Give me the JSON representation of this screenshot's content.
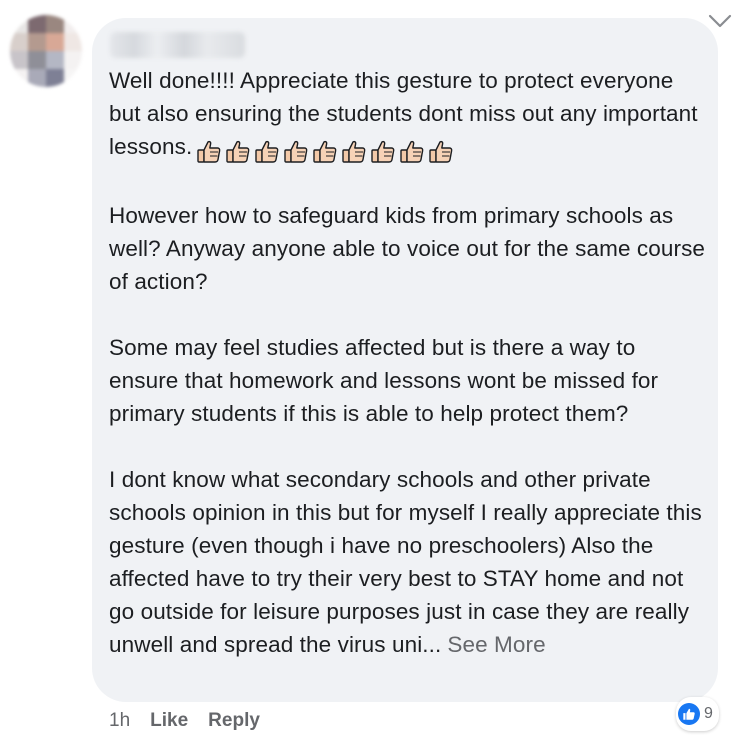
{
  "comment": {
    "paragraphs": [
      "Well done!!!! Appreciate this gesture to protect everyone but also ensuring the students dont miss out any important lessons.",
      "However how to safeguard kids from primary schools as well? Anyway anyone able to voice out for the same course of action?",
      "Some may feel studies affected but is there a way to ensure that homework and lessons wont be missed for primary students if this is able to help protect them?",
      "I dont know what secondary schools and other private schools opinion in this but for myself I really appreciate this gesture (even though i have no preschoolers) Also the affected have to try their very best to STAY home and not go outside for leisure purposes just in case they are really unwell and spread the virus uni..."
    ],
    "thumbs_emoji_count": 9,
    "see_more_label": "See More"
  },
  "footer": {
    "time": "1h",
    "like_label": "Like",
    "reply_label": "Reply"
  },
  "reactions": {
    "icon": "like-icon",
    "count": "9"
  },
  "icons": {
    "menu": "chevron-down-icon",
    "emoji": "thumbs-up-emoji-icon"
  },
  "colors": {
    "bubble": "#f0f2f5",
    "text": "#1c1e21",
    "secondary_text": "#65676b",
    "like_blue": "#1877f2"
  }
}
